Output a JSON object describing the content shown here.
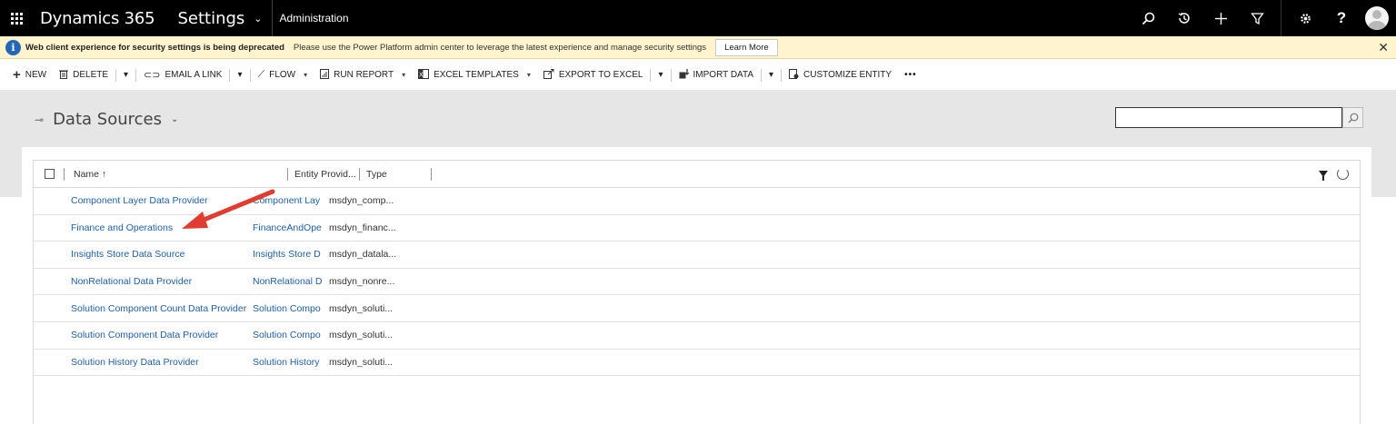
{
  "topbar": {
    "brand": "Dynamics 365",
    "area": "Settings",
    "subarea": "Administration",
    "icons": [
      "search-icon",
      "history-icon",
      "new-icon",
      "filter-icon",
      "settings-icon",
      "help-icon",
      "avatar"
    ]
  },
  "notification": {
    "title": "Web client experience for security settings is being deprecated",
    "message": "Please use the Power Platform admin center to leverage the latest experience and manage security settings",
    "button": "Learn More",
    "close": "✕"
  },
  "commands": {
    "new": "NEW",
    "delete": "DELETE",
    "email_link": "EMAIL A LINK",
    "flow": "FLOW",
    "run_report": "RUN REPORT",
    "excel_templates": "EXCEL TEMPLATES",
    "export_excel": "EXPORT TO EXCEL",
    "import_data": "IMPORT DATA",
    "customize_entity": "CUSTOMIZE ENTITY",
    "more": "•••"
  },
  "view": {
    "title": "Data Sources",
    "search_value": ""
  },
  "grid": {
    "columns": {
      "name": "Name ↑",
      "provider": "Entity Provid...",
      "type": "Type"
    },
    "rows": [
      {
        "name": "Component Layer Data Provider",
        "provider": "Component Lay",
        "type": "msdyn_comp..."
      },
      {
        "name": "Finance and Operations",
        "provider": "FinanceAndOpe",
        "type": "msdyn_financ..."
      },
      {
        "name": "Insights Store Data Source",
        "provider": "Insights Store D",
        "type": "msdyn_datala..."
      },
      {
        "name": "NonRelational Data Provider",
        "provider": "NonRelational D",
        "type": "msdyn_nonre..."
      },
      {
        "name": "Solution Component Count Data Provider",
        "provider": "Solution Compo",
        "type": "msdyn_soluti..."
      },
      {
        "name": "Solution Component Data Provider",
        "provider": "Solution Compo",
        "type": "msdyn_soluti..."
      },
      {
        "name": "Solution History Data Provider",
        "provider": "Solution History",
        "type": "msdyn_soluti..."
      }
    ]
  },
  "colors": {
    "topbar": "#000000",
    "notification_bg": "#fff4ce",
    "link": "#1f5fa8",
    "annotation_arrow": "#e03c31"
  }
}
